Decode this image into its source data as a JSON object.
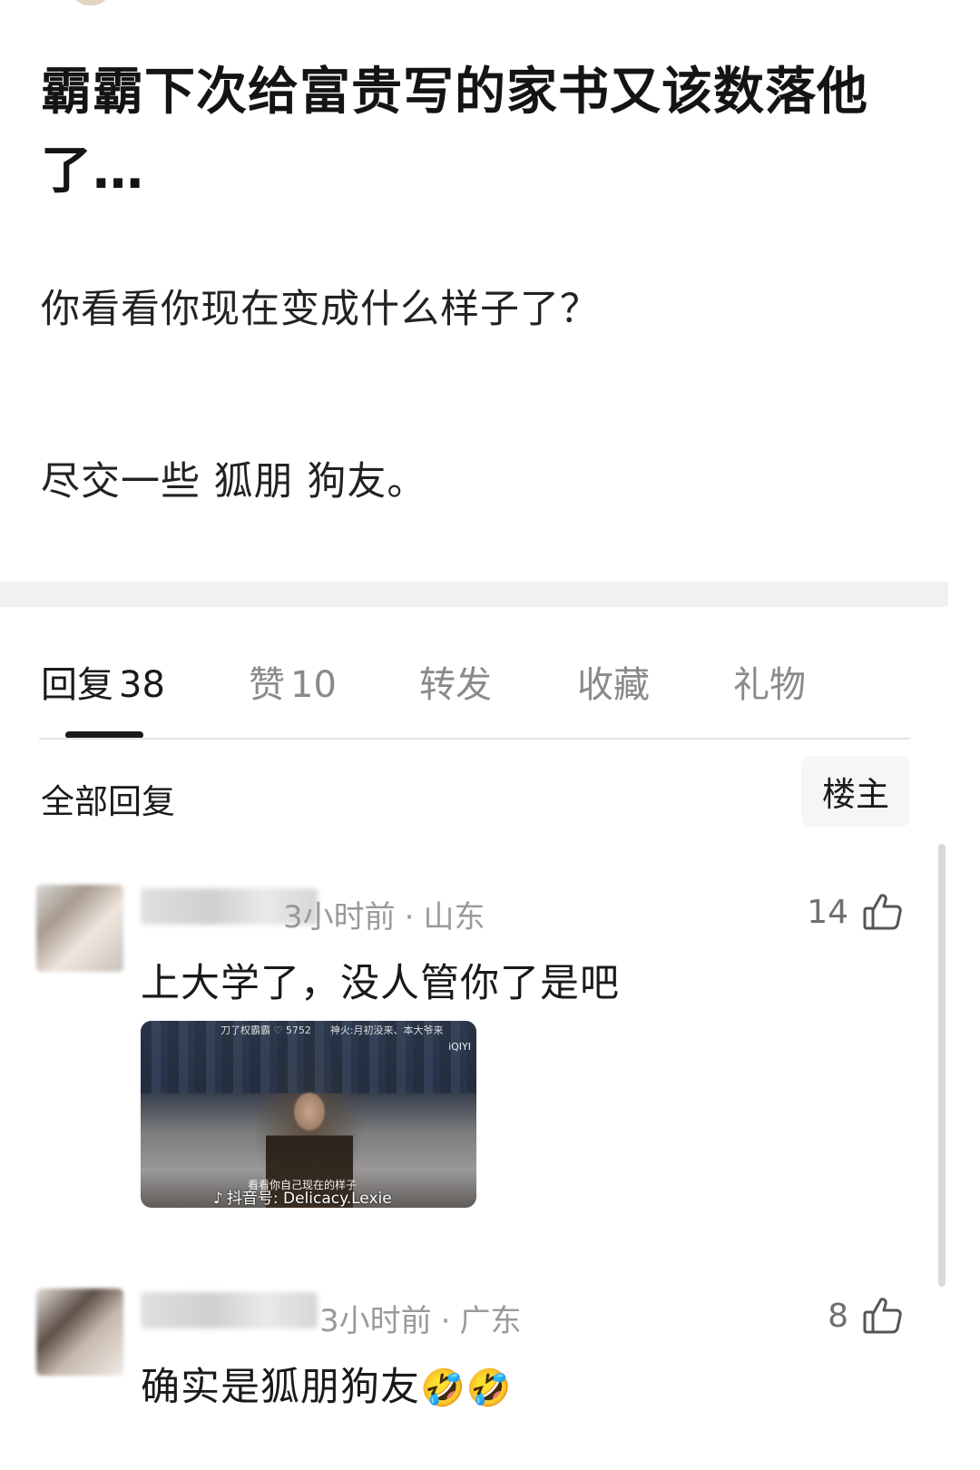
{
  "post": {
    "title": "霸霸下次给富贵写的家书又该数落他了…",
    "body_lines": [
      "你看看你现在变成什么样子了？",
      "尽交一些 狐朋 狗友。"
    ]
  },
  "tabs": [
    {
      "label": "回复",
      "count": "38"
    },
    {
      "label": "赞",
      "count": "10"
    },
    {
      "label": "转发",
      "count": ""
    },
    {
      "label": "收藏",
      "count": ""
    },
    {
      "label": "礼物",
      "count": ""
    }
  ],
  "replies_header": {
    "label": "全部回复",
    "op_only_label": "楼主"
  },
  "comments": [
    {
      "time": "3小时前",
      "location": "山东",
      "separator": "·",
      "likes": "14",
      "text": "上大学了，没人管你了是吧",
      "video": {
        "top_text": "刀了权霸霸 ♡ 5752",
        "top_right_text": "神火:月初没来、本大爷来",
        "brand": "iQIYI",
        "caption": "看看你自己现在的样子",
        "watermark": "抖音号: Delicacy.Lexie"
      }
    },
    {
      "time": "3小时前",
      "location": "广东",
      "separator": "·",
      "likes": "8",
      "text": "确实是狐朋狗友",
      "emojis": [
        "🤣",
        "🤣"
      ]
    }
  ],
  "colors": {
    "text": "#1a1a1a",
    "muted": "#9a9a9a",
    "divider_band": "#f1f1ef",
    "active_indicator": "#1a1a1a"
  }
}
